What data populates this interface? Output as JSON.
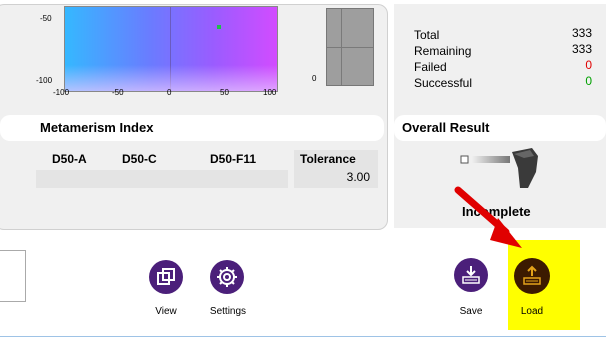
{
  "chart": {
    "y_ticks": [
      "-50",
      "-100"
    ],
    "x_ticks": [
      "-100",
      "-50",
      "0",
      "50",
      "100"
    ],
    "side_tick": "0"
  },
  "statistics": {
    "rows": [
      {
        "label": "Total",
        "value": "333",
        "color": "#000000"
      },
      {
        "label": "Remaining",
        "value": "333",
        "color": "#000000"
      },
      {
        "label": "Failed",
        "value": "0",
        "color": "#e00000"
      },
      {
        "label": "Successful",
        "value": "0",
        "color": "#00a000"
      }
    ]
  },
  "metamerism": {
    "title": "Metamerism Index",
    "columns": [
      "D50-A",
      "D50-C",
      "D50-F11"
    ],
    "tolerance_label": "Tolerance",
    "tolerance_value": "3.00"
  },
  "overall_result": {
    "title": "Overall Result",
    "status": "Incomplete"
  },
  "toolbar": {
    "view_label": "View",
    "settings_label": "Settings",
    "save_label": "Save",
    "load_label": "Load"
  },
  "colors": {
    "button_purple": "#4b1f7a",
    "load_button": "#3c1a00",
    "highlight_yellow": "#ffff00",
    "arrow_red": "#e00000"
  },
  "icons": [
    "view-icon",
    "settings-gear-icon",
    "save-icon",
    "load-icon",
    "arrow-icon",
    "device-icon"
  ]
}
